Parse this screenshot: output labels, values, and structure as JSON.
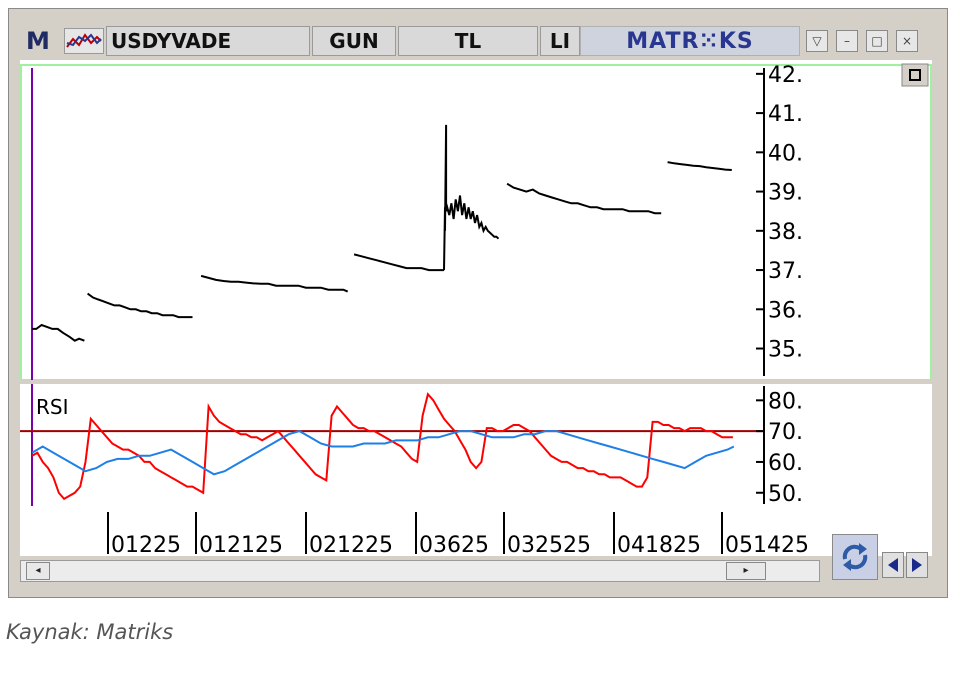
{
  "window": {
    "m_label": "M",
    "symbol": "USDYVADE",
    "period": "GUN",
    "currency": "TL",
    "tab_cut": "LI",
    "brand": "MATR⁙KS",
    "buttons": [
      "▽",
      "–",
      "□",
      "×"
    ]
  },
  "caption": "Kaynak: Matriks",
  "chart_data": [
    {
      "type": "line",
      "panel": "price",
      "ylim": [
        34.3,
        42.2
      ],
      "yticks": [
        35,
        36,
        37,
        38,
        39,
        40,
        41,
        42
      ],
      "ytick_labels": [
        "35.",
        "36.",
        "37.",
        "38.",
        "39.",
        "40.",
        "41.",
        "42."
      ],
      "segments": [
        {
          "x": [
            0,
            4,
            9,
            14,
            19,
            24,
            29,
            35,
            40,
            44,
            49
          ],
          "y": [
            35.5,
            35.5,
            35.6,
            35.55,
            35.5,
            35.5,
            35.4,
            35.3,
            35.2,
            35.25,
            35.2
          ]
        },
        {
          "x": [
            52,
            57,
            62,
            67,
            72,
            77,
            82,
            87,
            92,
            97,
            102,
            107,
            112,
            117,
            122,
            127,
            132,
            137,
            142,
            147,
            150
          ],
          "y": [
            36.4,
            36.3,
            36.25,
            36.2,
            36.15,
            36.1,
            36.1,
            36.05,
            36.0,
            36.0,
            35.95,
            35.95,
            35.9,
            35.9,
            35.85,
            35.85,
            35.85,
            35.8,
            35.8,
            35.8,
            35.8
          ]
        },
        {
          "x": [
            158,
            165,
            172,
            179,
            186,
            193,
            200,
            207,
            214,
            221,
            228,
            235,
            242,
            249,
            256,
            263,
            270,
            277,
            284,
            291,
            295
          ],
          "y": [
            36.85,
            36.8,
            36.75,
            36.72,
            36.7,
            36.7,
            36.68,
            36.66,
            36.65,
            36.65,
            36.6,
            36.6,
            36.6,
            36.6,
            36.55,
            36.55,
            36.55,
            36.5,
            36.5,
            36.5,
            36.45
          ]
        },
        {
          "x": [
            301,
            308,
            315,
            322,
            329,
            336,
            343,
            350,
            357,
            364,
            371,
            378,
            385
          ],
          "y": [
            37.4,
            37.35,
            37.3,
            37.25,
            37.2,
            37.15,
            37.1,
            37.05,
            37.05,
            37.05,
            37.0,
            37.0,
            37.0
          ]
        },
        {
          "x": [
            385,
            386,
            386,
            387,
            387,
            388,
            390,
            392,
            394,
            396,
            398,
            400,
            402,
            404,
            406,
            408,
            410,
            412,
            414,
            416,
            418,
            420,
            422,
            424,
            426,
            428,
            430,
            432,
            434,
            436
          ],
          "y": [
            37.0,
            38.6,
            38.0,
            40.7,
            38.5,
            38.6,
            38.4,
            38.7,
            38.3,
            38.8,
            38.5,
            38.9,
            38.4,
            38.7,
            38.3,
            38.6,
            38.3,
            38.5,
            38.2,
            38.4,
            38.1,
            38.2,
            38.0,
            38.1,
            38.0,
            37.95,
            37.9,
            37.85,
            37.85,
            37.8
          ]
        },
        {
          "x": [
            444,
            450,
            456,
            462,
            468,
            474,
            480,
            486,
            492,
            498,
            504,
            510,
            516,
            522,
            528,
            534,
            540,
            546,
            552,
            558,
            564,
            570,
            576,
            582,
            588
          ],
          "y": [
            39.2,
            39.1,
            39.05,
            39.0,
            39.05,
            38.95,
            38.9,
            38.85,
            38.8,
            38.75,
            38.7,
            38.7,
            38.65,
            38.6,
            38.6,
            38.55,
            38.55,
            38.55,
            38.55,
            38.5,
            38.5,
            38.5,
            38.5,
            38.45,
            38.45
          ]
        },
        {
          "x": [
            594,
            600,
            606,
            612,
            618,
            624,
            630,
            636,
            642,
            648,
            654
          ],
          "y": [
            39.75,
            39.72,
            39.7,
            39.68,
            39.66,
            39.65,
            39.62,
            39.6,
            39.58,
            39.56,
            39.55
          ]
        }
      ]
    },
    {
      "type": "line",
      "panel": "rsi",
      "title": "RSI",
      "ylim": [
        47,
        84
      ],
      "yticks": [
        50,
        60,
        70,
        80
      ],
      "ytick_labels": [
        "50.",
        "60.",
        "70.",
        "80."
      ],
      "reference_line": 70,
      "series": [
        {
          "color": "#ff0000",
          "x": [
            0,
            5,
            10,
            15,
            20,
            25,
            30,
            35,
            40,
            45,
            50,
            55,
            60,
            65,
            70,
            75,
            80,
            85,
            90,
            95,
            100,
            105,
            110,
            115,
            120,
            125,
            130,
            135,
            140,
            145,
            150,
            155,
            160,
            165,
            170,
            175,
            180,
            185,
            190,
            195,
            200,
            205,
            210,
            215,
            220,
            225,
            230,
            235,
            240,
            245,
            250,
            255,
            260,
            265,
            270,
            275,
            280,
            285,
            290,
            295,
            300,
            305,
            310,
            315,
            320,
            325,
            330,
            335,
            340,
            345,
            350,
            355,
            360,
            365,
            370,
            375,
            380,
            385,
            390,
            395,
            400,
            405,
            410,
            415,
            420,
            425,
            430,
            435,
            440,
            445,
            450,
            455,
            460,
            465,
            470,
            475,
            480,
            485,
            490,
            495,
            500,
            505,
            510,
            515,
            520,
            525,
            530,
            535,
            540,
            545,
            550,
            555,
            560,
            565,
            570,
            575,
            580,
            585,
            590,
            595,
            600,
            605,
            610,
            615,
            620,
            625,
            630,
            635,
            640,
            645,
            650,
            655
          ],
          "y": [
            62,
            63,
            60,
            58,
            55,
            50,
            48,
            49,
            50,
            52,
            60,
            74,
            72,
            70,
            68,
            66,
            65,
            64,
            64,
            63,
            62,
            60,
            60,
            58,
            57,
            56,
            55,
            54,
            53,
            52,
            52,
            51,
            50,
            78,
            75,
            73,
            72,
            71,
            70,
            69,
            69,
            68,
            68,
            67,
            68,
            69,
            70,
            68,
            66,
            64,
            62,
            60,
            58,
            56,
            55,
            54,
            75,
            78,
            76,
            74,
            72,
            71,
            71,
            70,
            70,
            69,
            68,
            67,
            66,
            65,
            63,
            61,
            60,
            75,
            82,
            80,
            77,
            74,
            72,
            70,
            67,
            64,
            60,
            58,
            60,
            71,
            71,
            70,
            70,
            71,
            72,
            72,
            71,
            70,
            68,
            66,
            64,
            62,
            61,
            60,
            60,
            59,
            58,
            58,
            57,
            57,
            56,
            56,
            55,
            55,
            55,
            54,
            53,
            52,
            52,
            55,
            73,
            73,
            72,
            72,
            71,
            71,
            70,
            71,
            71,
            71,
            70,
            70,
            69,
            68,
            68,
            68
          ]
        },
        {
          "color": "#1e7fe6",
          "x": [
            0,
            10,
            20,
            30,
            40,
            50,
            60,
            70,
            80,
            90,
            100,
            110,
            120,
            130,
            140,
            150,
            160,
            170,
            180,
            190,
            200,
            210,
            220,
            230,
            240,
            250,
            260,
            270,
            280,
            290,
            300,
            310,
            320,
            330,
            340,
            350,
            360,
            370,
            380,
            390,
            400,
            410,
            420,
            430,
            440,
            450,
            460,
            470,
            480,
            490,
            500,
            510,
            520,
            530,
            540,
            550,
            560,
            570,
            580,
            590,
            600,
            610,
            620,
            630,
            640,
            650,
            656
          ],
          "y": [
            63,
            65,
            63,
            61,
            59,
            57,
            58,
            60,
            61,
            61,
            62,
            62,
            63,
            64,
            62,
            60,
            58,
            56,
            57,
            59,
            61,
            63,
            65,
            67,
            69,
            70,
            68,
            66,
            65,
            65,
            65,
            66,
            66,
            66,
            67,
            67,
            67,
            68,
            68,
            69,
            70,
            70,
            69,
            68,
            68,
            68,
            69,
            69,
            70,
            70,
            69,
            68,
            67,
            66,
            65,
            64,
            63,
            62,
            61,
            60,
            59,
            58,
            60,
            62,
            63,
            64,
            65
          ]
        }
      ]
    },
    {
      "type": "table",
      "panel": "x-axis",
      "tick_labels": [
        "01225",
        "012125",
        "021225",
        "03625",
        "032525",
        "041825",
        "051425"
      ]
    }
  ]
}
